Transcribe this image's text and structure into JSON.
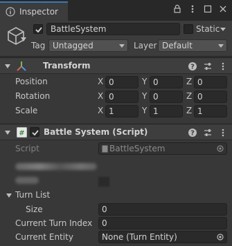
{
  "tab": {
    "title": "Inspector",
    "icon": "info-icon"
  },
  "object": {
    "name": "BattleSystem",
    "active": true,
    "static_label": "Static",
    "tag_label": "Tag",
    "tag_value": "Untagged",
    "layer_label": "Layer",
    "layer_value": "Default"
  },
  "transform": {
    "title": "Transform",
    "rows": [
      {
        "label": "Position",
        "x": "0",
        "y": "0",
        "z": "0"
      },
      {
        "label": "Rotation",
        "x": "0",
        "y": "0",
        "z": "0"
      },
      {
        "label": "Scale",
        "x": "1",
        "y": "1",
        "z": "1"
      }
    ],
    "axes": [
      "X",
      "Y",
      "Z"
    ]
  },
  "script_component": {
    "title": "Battle System (Script)",
    "enabled": true,
    "script_label": "Script",
    "script_value": "BattleSystem",
    "turn_list_label": "Turn List",
    "size_label": "Size",
    "size_value": "0",
    "current_turn_index_label": "Current Turn Index",
    "current_turn_index_value": "0",
    "current_entity_label": "Current Entity",
    "current_entity_value": "None (Turn Entity)"
  },
  "colors": {
    "accent": "#3a79bb",
    "background": "#383838"
  }
}
